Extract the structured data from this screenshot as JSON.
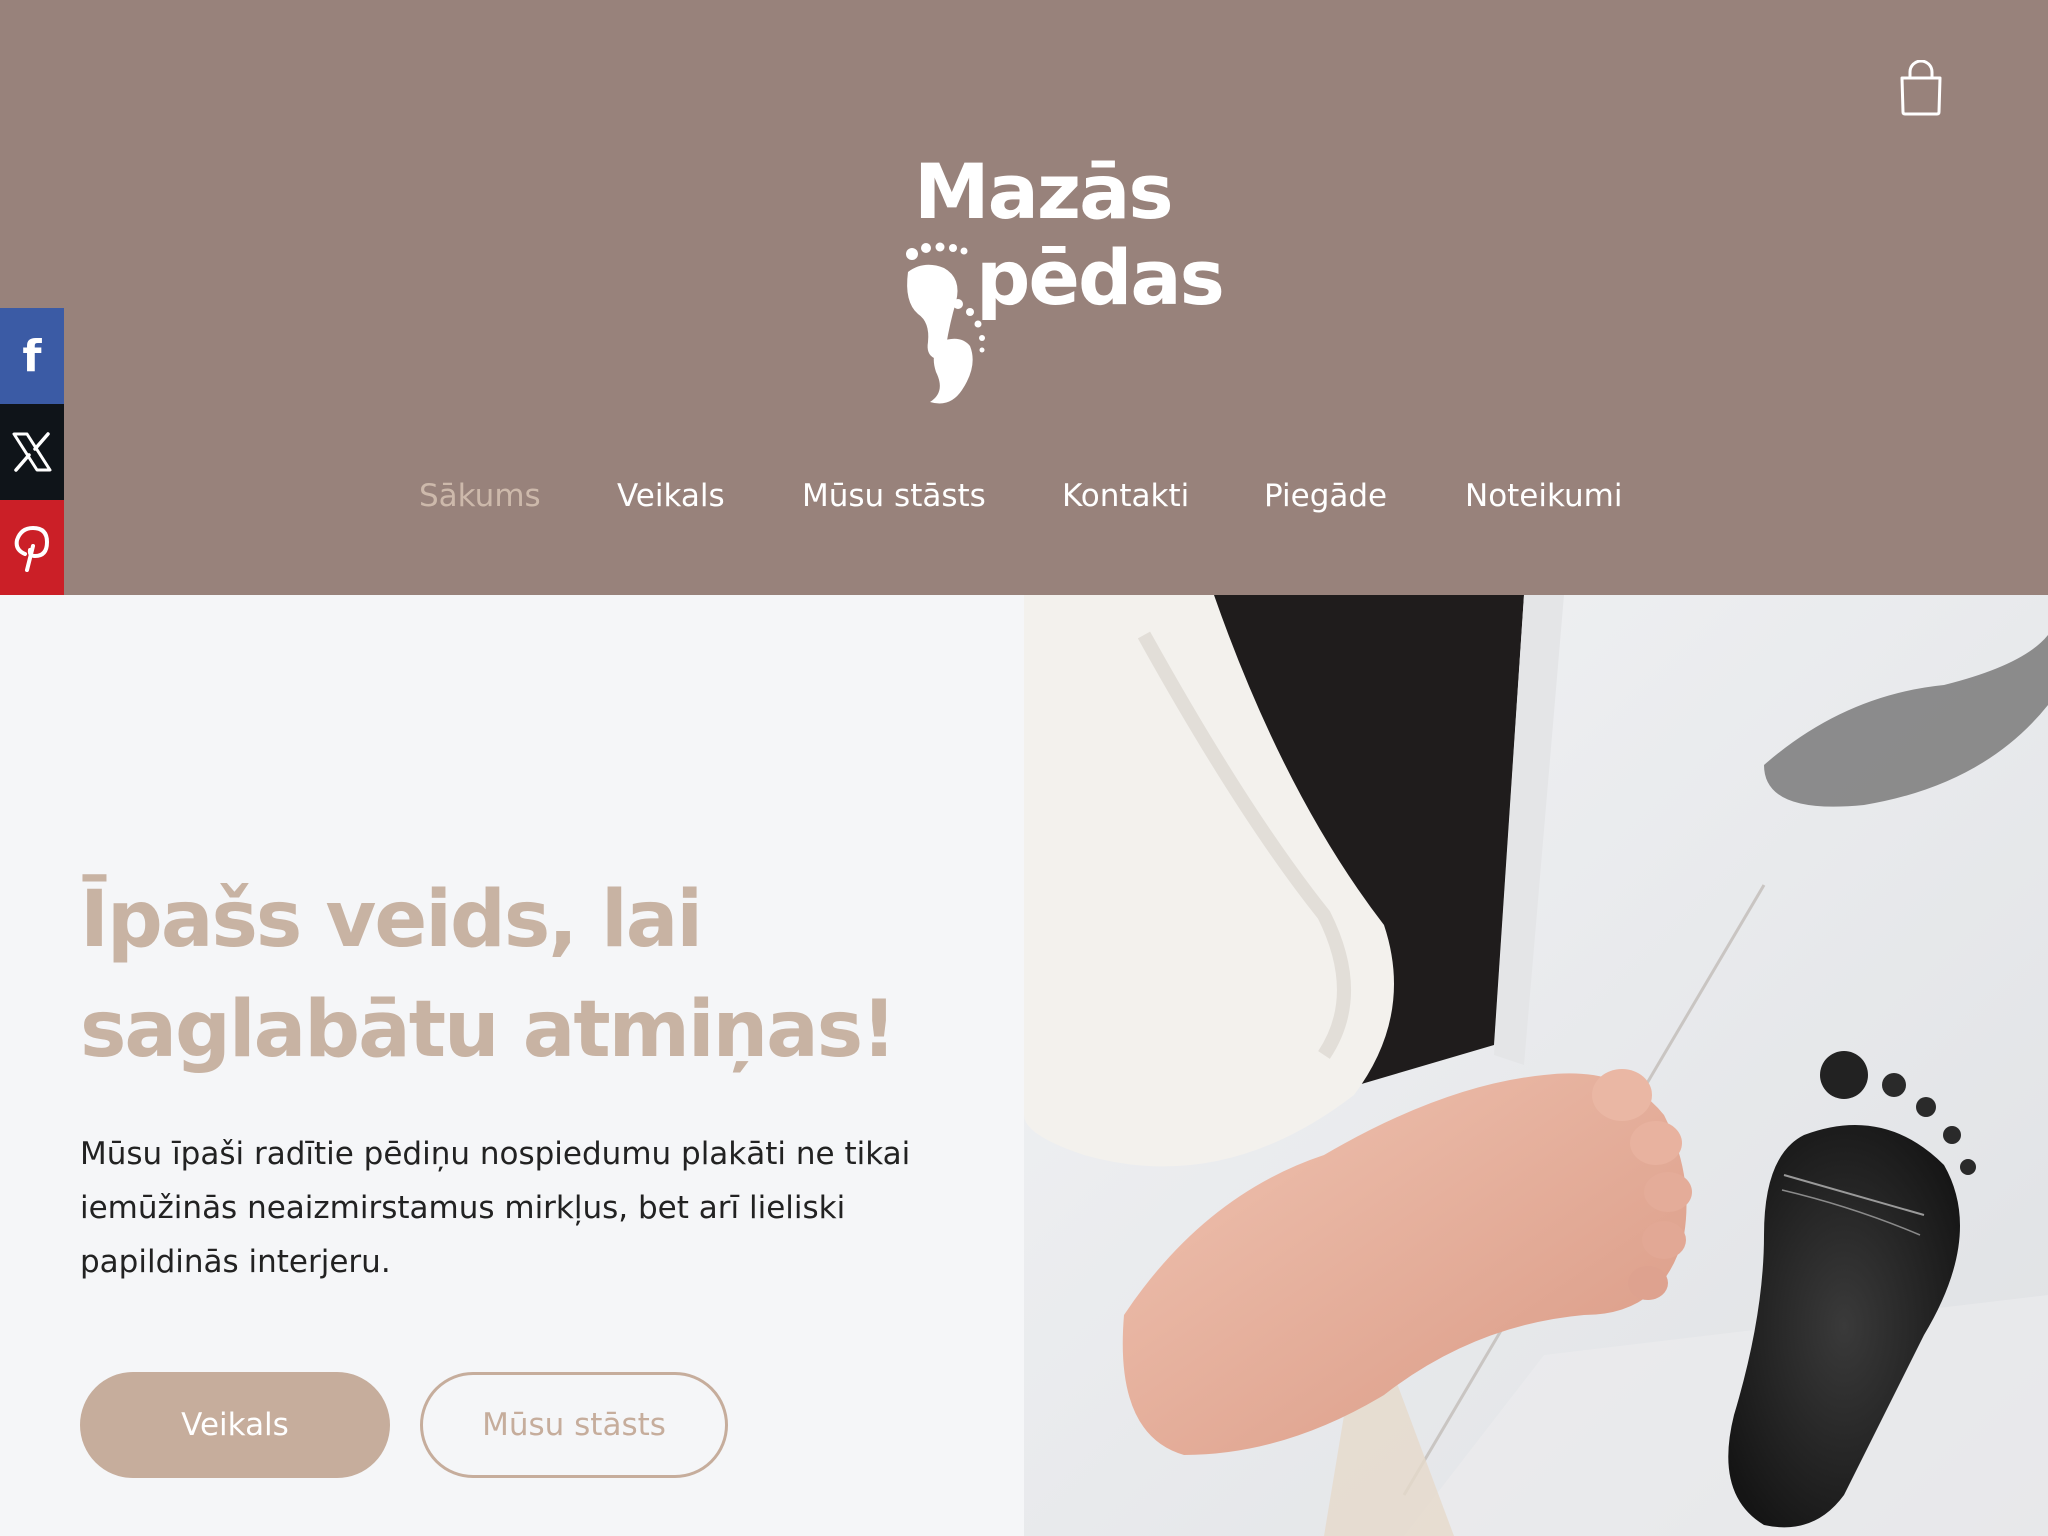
{
  "header": {
    "cart_icon": "shopping-bag-icon",
    "logo": {
      "line1": "Mazās",
      "line2": "pēdas",
      "icon": "footprint-icon"
    },
    "nav": [
      {
        "label": "Sākums",
        "active": true
      },
      {
        "label": "Veikals",
        "active": false
      },
      {
        "label": "Mūsu stāsts",
        "active": false
      },
      {
        "label": "Kontakti",
        "active": false
      },
      {
        "label": "Piegāde",
        "active": false
      },
      {
        "label": "Noteikumi",
        "active": false
      }
    ]
  },
  "social": [
    {
      "network": "facebook",
      "icon": "facebook-icon",
      "color": "#3b5ba5"
    },
    {
      "network": "x",
      "icon": "x-icon",
      "color": "#0f1419"
    },
    {
      "network": "pinterest",
      "icon": "pinterest-icon",
      "color": "#cb1f27"
    }
  ],
  "hero": {
    "headline": "Īpašs veids, lai saglabātu atmiņas!",
    "paragraph": "Mūsu īpaši radītie pēdiņu nospiedumu plakāti ne tikai iemūžinās neaizmirstamus mirkļus, bet arī lieliski papildinās interjeru.",
    "primary_button": "Veikals",
    "secondary_button": "Mūsu stāsts",
    "image": "baby-foot-and-footprint-photo"
  },
  "colors": {
    "header_bg": "#98827b",
    "accent": "#c8b3a3",
    "nav_active": "#cdb9ab",
    "page_bg": "#f5f6f8"
  }
}
